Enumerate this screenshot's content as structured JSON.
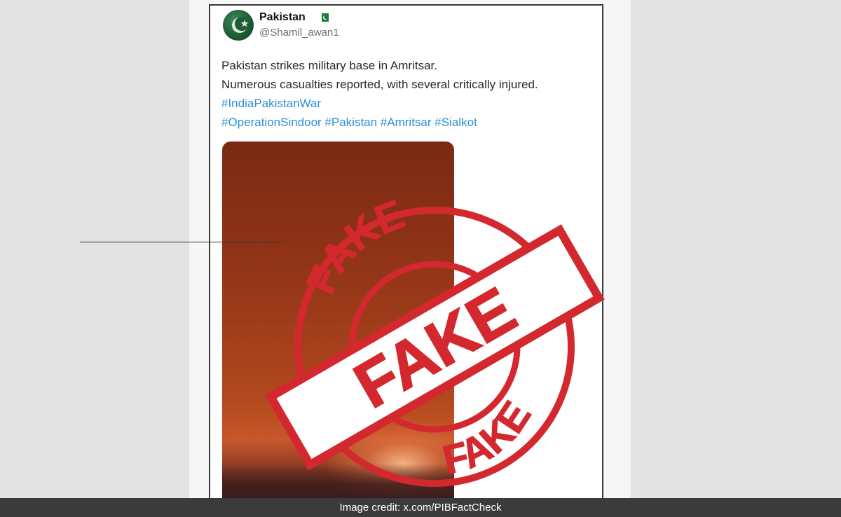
{
  "tweet": {
    "display_name": "Pakistan",
    "handle": "@Shamil_awan1",
    "lines": [
      "Pakistan strikes military base in Amritsar.",
      "Numerous casualties reported, with several critically injured."
    ],
    "hashtag_line1": "#IndiaPakistanWar",
    "hashtag_line2": "#OperationSindoor #Pakistan #Amritsar #Sialkot",
    "flag_icon": "pakistan-flag-icon",
    "colors": {
      "hashtag": "#2e8fd6",
      "handle": "#6b6f75"
    }
  },
  "stamp": {
    "top_word": "FAKE",
    "band_word": "FAKE",
    "bottom_word": "FAKE",
    "color": "#d3282e"
  },
  "footer": {
    "credit": "Image credit: x.com/PIBFactCheck"
  }
}
